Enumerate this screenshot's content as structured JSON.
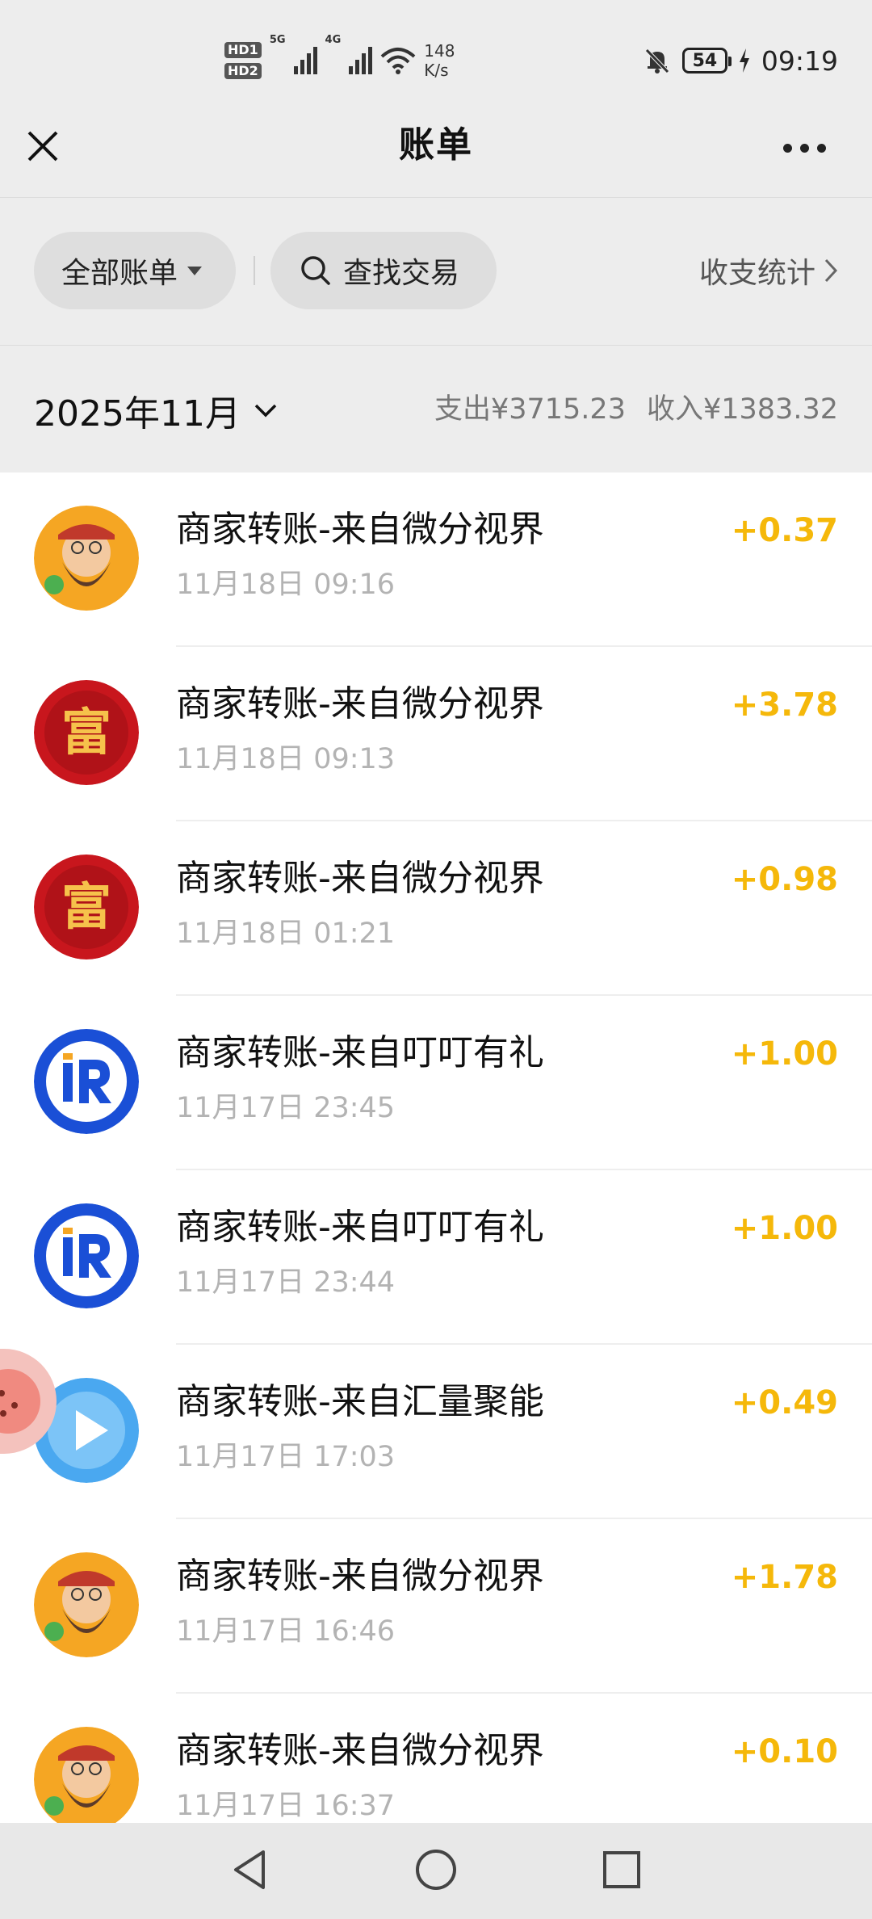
{
  "status_bar": {
    "hd1": "HD1",
    "hd2": "HD2",
    "net1": "5G",
    "net2": "4G",
    "speed_value": "148",
    "speed_unit": "K/s",
    "battery": "54",
    "time": "09:19"
  },
  "nav": {
    "title": "账单"
  },
  "filters": {
    "all_bills": "全部账单",
    "search": "查找交易",
    "stats": "收支统计"
  },
  "month": {
    "label": "2025年11月",
    "expense": "支出¥3715.23",
    "income": "收入¥1383.32"
  },
  "transactions": [
    {
      "title": "商家转账-来自微分视界",
      "time": "11月18日 09:16",
      "amount": "+0.37",
      "avatar": "fortune-god-icon"
    },
    {
      "title": "商家转账-来自微分视界",
      "time": "11月18日 09:13",
      "amount": "+3.78",
      "avatar": "fu-character-icon",
      "avatar_text": "富"
    },
    {
      "title": "商家转账-来自微分视界",
      "time": "11月18日 01:21",
      "amount": "+0.98",
      "avatar": "fu-character-icon",
      "avatar_text": "富"
    },
    {
      "title": "商家转账-来自叮叮有礼",
      "time": "11月17日 23:45",
      "amount": "+1.00",
      "avatar": "lr-logo-icon"
    },
    {
      "title": "商家转账-来自叮叮有礼",
      "time": "11月17日 23:44",
      "amount": "+1.00",
      "avatar": "lr-logo-icon"
    },
    {
      "title": "商家转账-来自汇量聚能",
      "time": "11月17日 17:03",
      "amount": "+0.49",
      "avatar": "play-logo-icon"
    },
    {
      "title": "商家转账-来自微分视界",
      "time": "11月17日 16:46",
      "amount": "+1.78",
      "avatar": "fortune-god-icon"
    },
    {
      "title": "商家转账-来自微分视界",
      "time": "11月17日 16:37",
      "amount": "+0.10",
      "avatar": "fortune-god-icon"
    }
  ],
  "colors": {
    "amount": "#f5b80a",
    "background": "#ededed",
    "lr_blue": "#1a4fd6",
    "fu_red": "#c8161d"
  }
}
